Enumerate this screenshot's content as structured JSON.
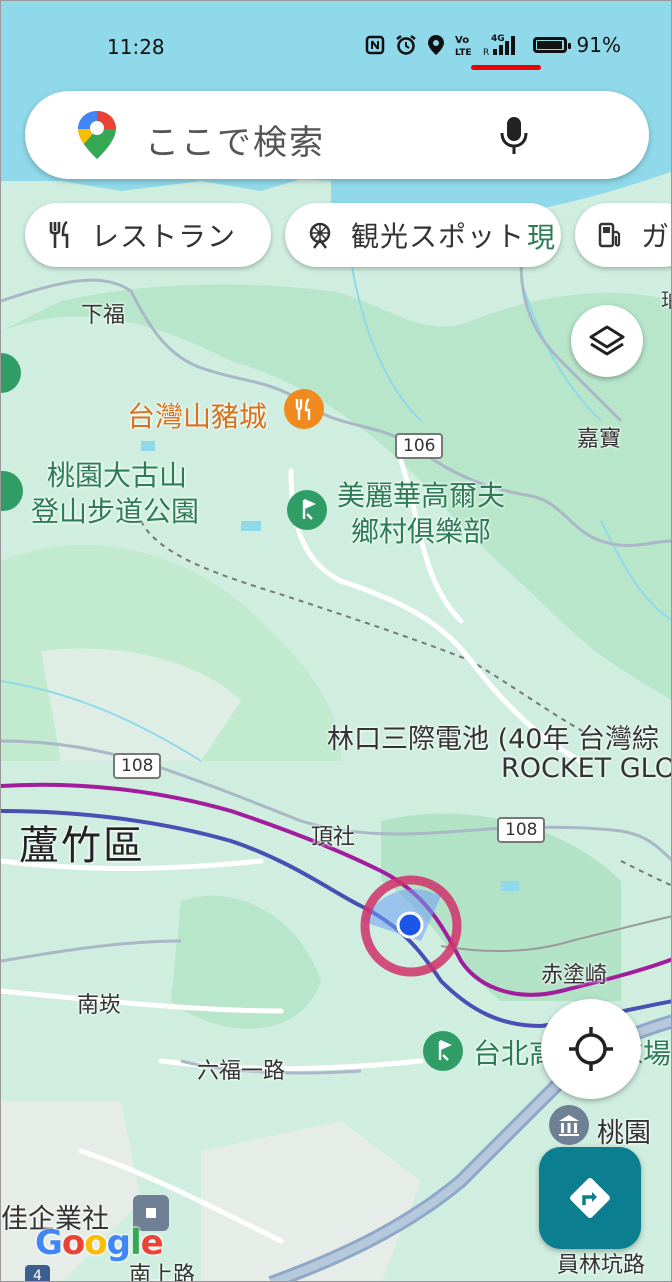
{
  "status_bar": {
    "time": "11:28",
    "battery": "91%",
    "battery_level": 0.91,
    "icons": [
      "nfc-icon",
      "alarm-icon",
      "location-icon",
      "volte-icon",
      "signal-4g-icon",
      "battery-icon"
    ]
  },
  "search": {
    "placeholder": "ここで検索"
  },
  "chips": [
    {
      "label": "レストラン",
      "icon": "restaurant-icon"
    },
    {
      "label": "観光スポット",
      "icon": "attractions-icon"
    },
    {
      "label": "ガ",
      "icon": "gas-station-icon"
    }
  ],
  "map": {
    "places": {
      "xiafu": "下福",
      "pig_castle": "台灣山豬城",
      "taoyuan_trail_1": "桃園大古山",
      "taoyuan_trail_2": "登山步道公園",
      "golf_1": "美麗華高爾夫",
      "golf_2": "鄉村俱樂部",
      "jiabao": "嘉寶",
      "rocket_1": "林口三際電池 (40年 台灣綜",
      "rocket_2": "ROCKET GLO",
      "luzhu": "蘆竹區",
      "dingshe": "頂社",
      "chituqi": "赤塗崎",
      "nankan": "南崁",
      "liufu_road": "六福一路",
      "taipei_golf": "台北高",
      "taipei_golf_tail": "球場",
      "taoyuan_right": "桃園",
      "company": "佳企業社",
      "nanshang": "南上路",
      "yuanlin": "員林坑路",
      "edge_right": "現",
      "edge_right_2": "珀"
    },
    "roads": {
      "r106": "106",
      "r108a": "108",
      "r108b": "108",
      "r4": "4"
    },
    "google": "Google",
    "colors": {
      "land": "#cfeee0",
      "forest": "#b3e3c7",
      "road": "#ffffff",
      "highway": "#8ea8c8",
      "rail_purple": "#a21d9c",
      "rail_blue": "#4a4fb3",
      "water": "#8fd9ea",
      "location_dot": "#1a56e8",
      "accuracy_ring": "#d0306a"
    }
  }
}
